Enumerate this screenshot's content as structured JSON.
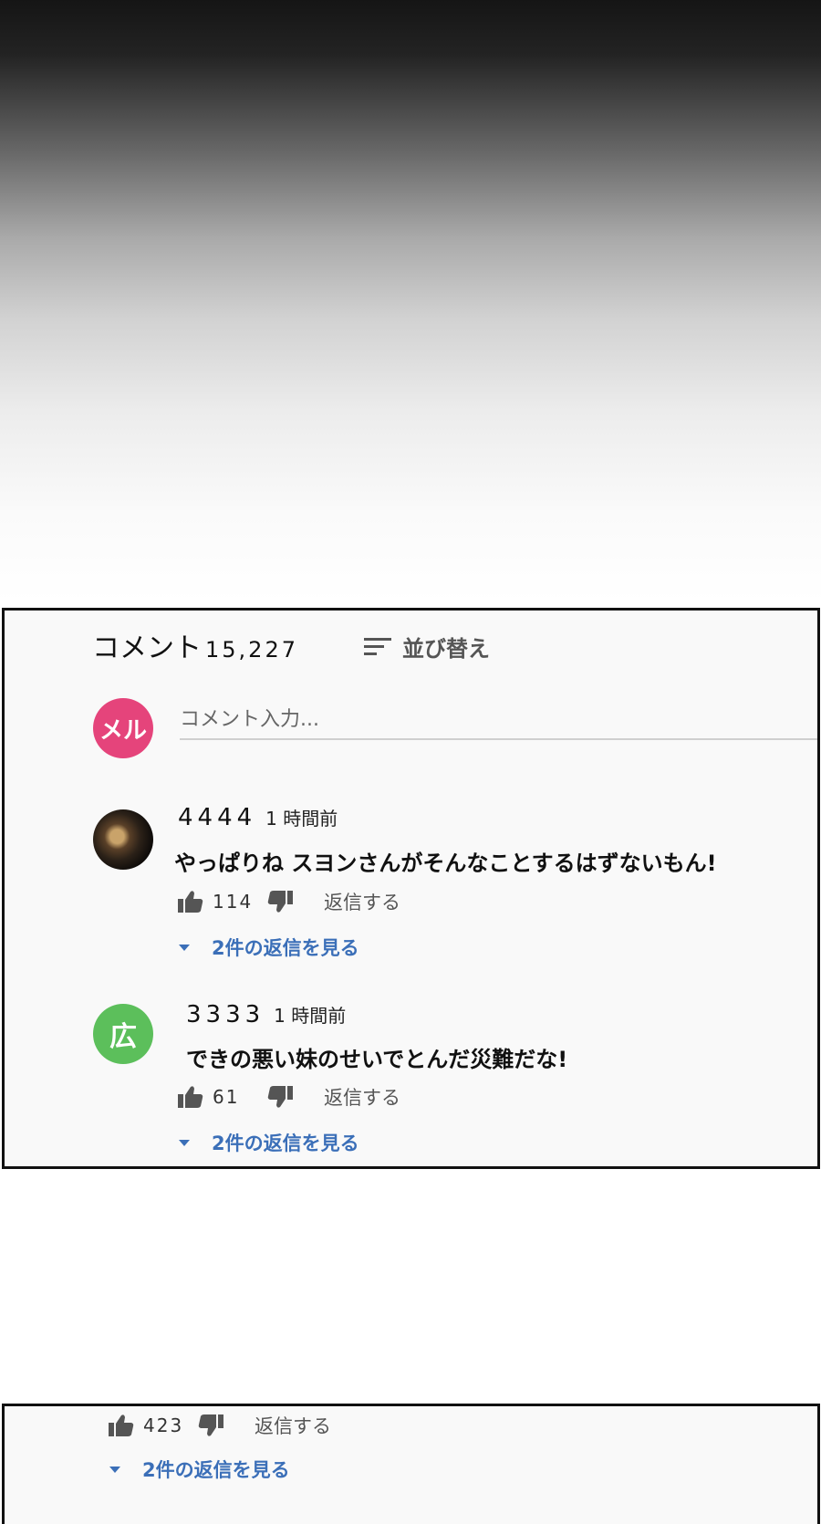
{
  "comments_panel": {
    "header_label": "コメント",
    "comment_count": "15,227",
    "sort_label": "並び替え",
    "user_avatar_text": "メル",
    "input_placeholder": "コメント入力...",
    "comments": [
      {
        "author": "4444",
        "time": "1 時間前",
        "text": "やっぱりね スヨンさんがそんなことするはずないもん!",
        "likes": "114",
        "reply_label": "返信する",
        "view_replies_label": "2件の返信を見る"
      },
      {
        "avatar_text": "広",
        "author": "3333",
        "time": "1 時間前",
        "text": "できの悪い妹のせいでとんだ災難だな!",
        "likes": "61",
        "reply_label": "返信する",
        "view_replies_label": "2件の返信を見る"
      }
    ]
  },
  "lower_panel": {
    "likes": "423",
    "reply_label": "返信する",
    "view_replies_label": "2件の返信を見る"
  },
  "colors": {
    "user_avatar": "#e5447b",
    "green_avatar": "#5cbf5b",
    "link_blue": "#3b6fb8"
  }
}
